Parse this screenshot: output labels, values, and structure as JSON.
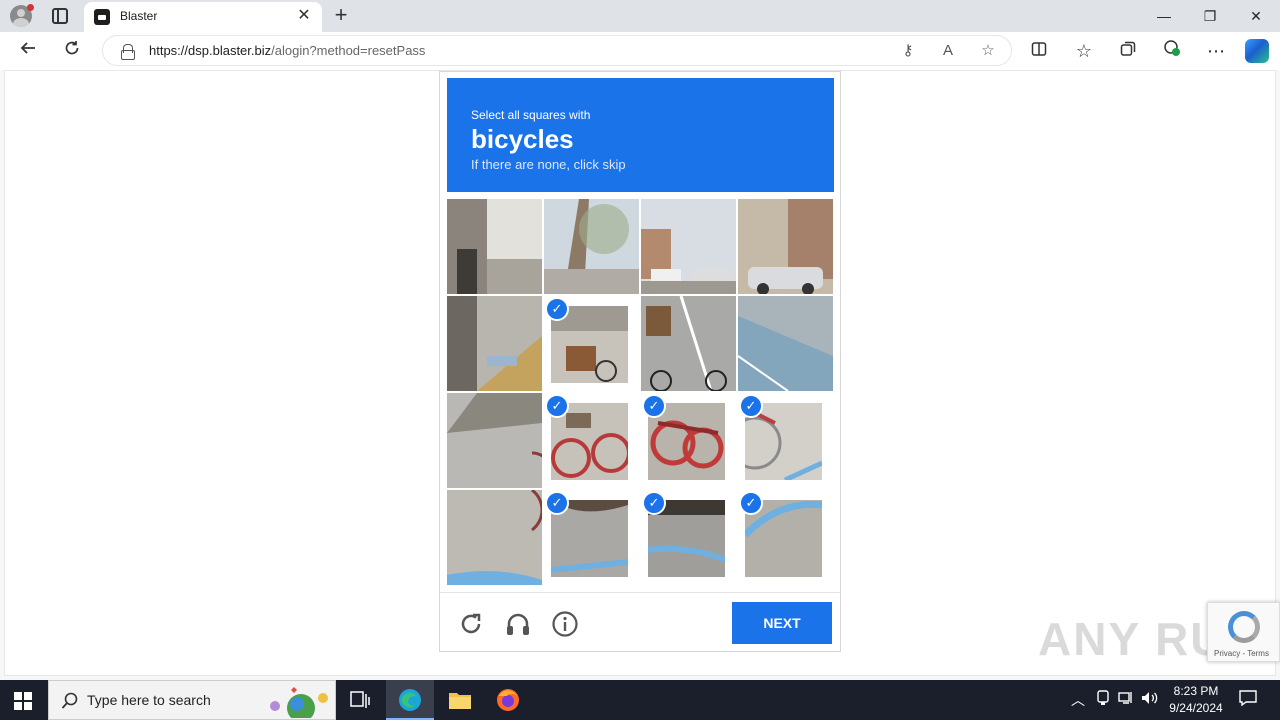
{
  "browser": {
    "tab_title": "Blaster",
    "url_host": "https://dsp.blaster.biz",
    "url_path": "/alogin?method=resetPass",
    "controls": {
      "minimize": "—",
      "restore": "❐",
      "close": "✕"
    },
    "tab_close": "✕",
    "new_tab": "+"
  },
  "captcha": {
    "instruction": "Select all squares with",
    "keyword": "bicycles",
    "hint": "If there are none, click skip",
    "next_label": "NEXT",
    "check_mark": "✓",
    "tiles": [
      {
        "selected": false
      },
      {
        "selected": false
      },
      {
        "selected": false
      },
      {
        "selected": false
      },
      {
        "selected": false
      },
      {
        "selected": true
      },
      {
        "selected": false
      },
      {
        "selected": false
      },
      {
        "selected": false
      },
      {
        "selected": true
      },
      {
        "selected": true
      },
      {
        "selected": true
      },
      {
        "selected": false
      },
      {
        "selected": true
      },
      {
        "selected": true
      },
      {
        "selected": true
      }
    ]
  },
  "recaptcha_badge": {
    "text": "Privacy - Terms"
  },
  "watermark": "ANY RUN",
  "taskbar": {
    "search_placeholder": "Type here to search",
    "time": "8:23 PM",
    "date": "9/24/2024"
  },
  "colors": {
    "accent": "#1a73e8",
    "taskbar": "#1b1f2b"
  }
}
